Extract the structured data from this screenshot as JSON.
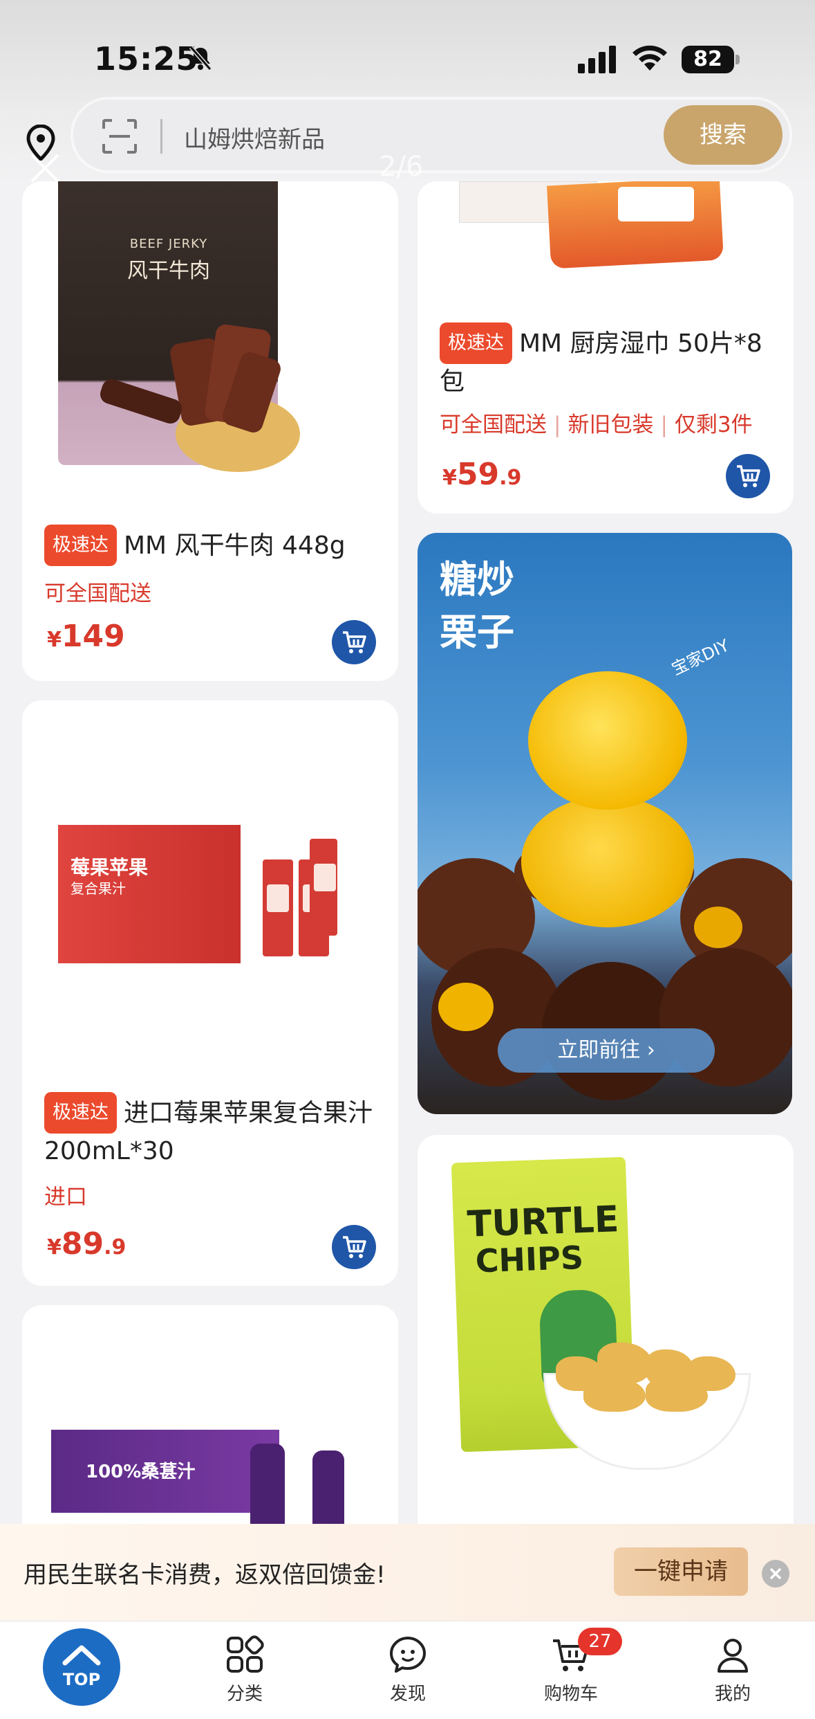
{
  "status_bar": {
    "time": "15:25",
    "battery": "82"
  },
  "search": {
    "placeholder": "山姆烘焙新品",
    "button_label": "搜索"
  },
  "pager": "2/6",
  "products": {
    "jerky": {
      "badge": "极速达",
      "title": "MM 风干牛肉 448g",
      "tags": [
        "可全国配送"
      ],
      "price_currency": "¥",
      "price_int": "149",
      "price_dec": "",
      "package_text_en": "BEEF JERKY",
      "package_text_cn": "风干牛肉"
    },
    "wipes": {
      "badge": "极速达",
      "title": "MM 厨房湿巾 50片*8包",
      "tags": [
        "可全国配送",
        "新旧包装",
        "仅剩3件"
      ],
      "price_currency": "¥",
      "price_int": "59",
      "price_dec": ".9"
    },
    "juice": {
      "badge": "极速达",
      "title": "进口莓果苹果复合果汁 200mL*30",
      "tags": [
        "进口"
      ],
      "price_currency": "¥",
      "price_int": "89",
      "price_dec": ".9",
      "package_text": "莓果苹果",
      "package_sub": "复合果汁"
    },
    "mulberry": {
      "package_text": "100%桑葚汁"
    },
    "chips": {
      "package_line1": "TURTLE",
      "package_line2": "CHIPS"
    }
  },
  "banner": {
    "title": "糖炒栗子",
    "tag": "宝家DIY",
    "cta": "立即前往 ›"
  },
  "promo": {
    "text": "用民生联名卡消费，返双倍回馈金!",
    "button_label": "一键申请"
  },
  "tabbar": {
    "top_label": "TOP",
    "items": [
      {
        "label": "分类",
        "icon": "category-icon"
      },
      {
        "label": "发现",
        "icon": "discover-icon"
      },
      {
        "label": "购物车",
        "icon": "cart-icon"
      },
      {
        "label": "我的",
        "icon": "profile-icon"
      }
    ],
    "cart_count": "27"
  },
  "colors": {
    "accent_gold": "#c9a56c",
    "price_red": "#d8392b",
    "badge_red": "#ec4a2c",
    "brand_blue": "#1f56a8"
  }
}
